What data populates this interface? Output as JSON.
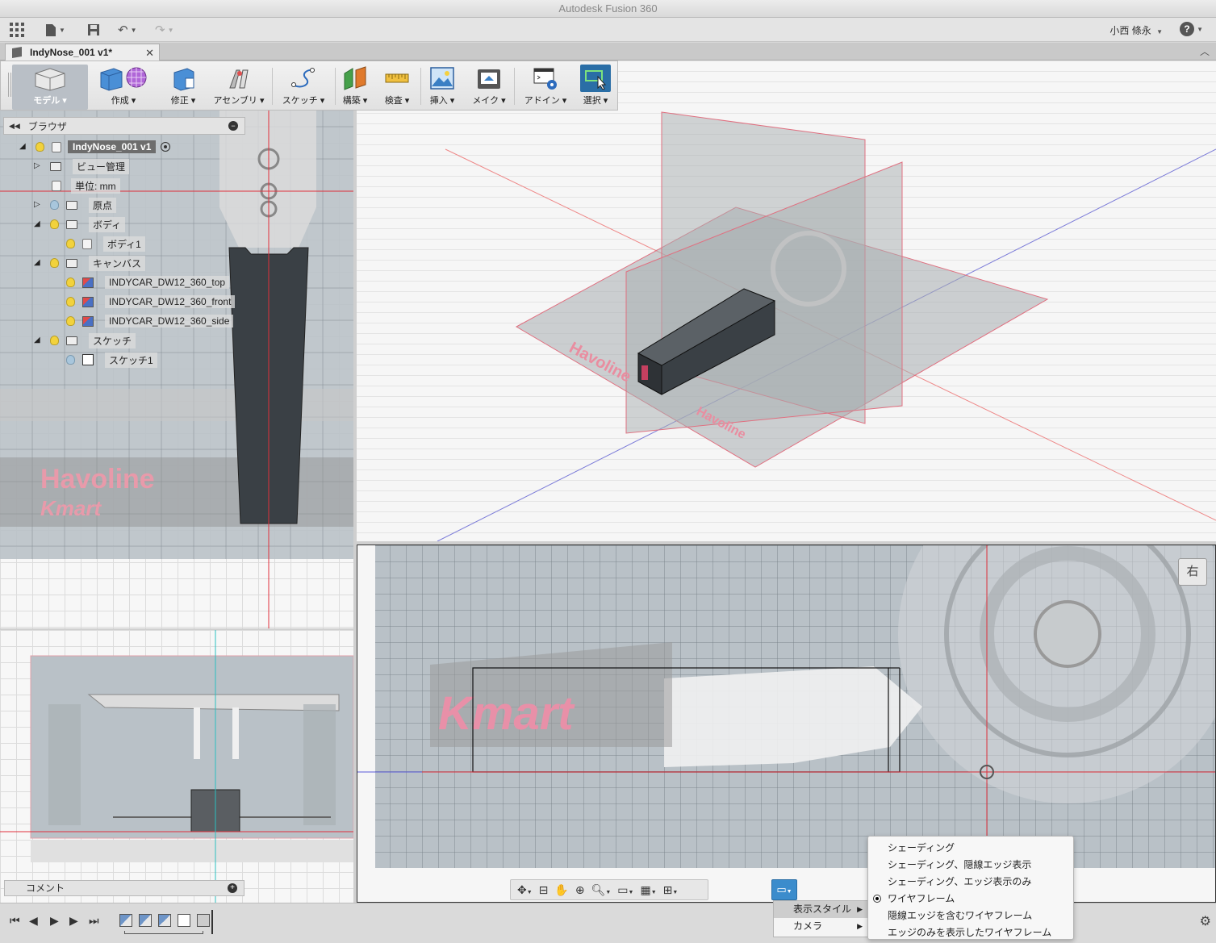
{
  "window": {
    "title": "Autodesk Fusion 360"
  },
  "app_toolbar": {
    "user_name": "小西 條永",
    "help_icon": "?"
  },
  "tab": {
    "label": "IndyNose_001 v1*",
    "close": "✕"
  },
  "ribbon": {
    "items": [
      {
        "label": "モデル",
        "icon": "model-cube-icon",
        "active": true
      },
      {
        "label": "作成",
        "icon": "box-icon"
      },
      {
        "label": "修正",
        "icon": "modify-icon"
      },
      {
        "label": "アセンブリ",
        "icon": "joint-icon"
      },
      {
        "label": "スケッチ",
        "icon": "sketch-spline-icon"
      },
      {
        "label": "構築",
        "icon": "construct-plane-icon"
      },
      {
        "label": "検査",
        "icon": "ruler-icon"
      },
      {
        "label": "挿入",
        "icon": "image-insert-icon"
      },
      {
        "label": "メイク",
        "icon": "3d-print-icon"
      },
      {
        "label": "アドイン",
        "icon": "addin-gear-icon"
      },
      {
        "label": "選択",
        "icon": "select-cursor-icon"
      }
    ]
  },
  "browser": {
    "title": "ブラウザ",
    "root": "IndyNose_001 v1",
    "nodes": {
      "view_mgmt": "ビュー管理",
      "units": "単位: mm",
      "origin": "原点",
      "bodies": "ボディ",
      "body1": "ボディ1",
      "canvases": "キャンバス",
      "canvas_top": "INDYCAR_DW12_360_top",
      "canvas_front": "INDYCAR_DW12_360_front",
      "canvas_side": "INDYCAR_DW12_360_side",
      "sketches": "スケッチ",
      "sketch1": "スケッチ1"
    }
  },
  "canvas_art": {
    "brand1": "Havoline",
    "brand2": "Kmart"
  },
  "comments": {
    "title": "コメント"
  },
  "viewports": {
    "right_view_label": "右"
  },
  "submenu": {
    "items": [
      {
        "label": "表示スタイル",
        "highlighted": true
      },
      {
        "label": "カメラ",
        "highlighted": false
      }
    ]
  },
  "style_menu": {
    "items": [
      "シェーディング",
      "シェーディング、隠線エッジ表示",
      "シェーディング、エッジ表示のみ",
      "ワイヤフレーム",
      "隠線エッジを含むワイヤフレーム",
      "エッジのみを表示したワイヤフレーム"
    ],
    "selected": "ワイヤフレーム"
  },
  "colors": {
    "accent": "#3b8ccc",
    "axis_red": "#e0303c",
    "body_dark": "#3a4045"
  }
}
